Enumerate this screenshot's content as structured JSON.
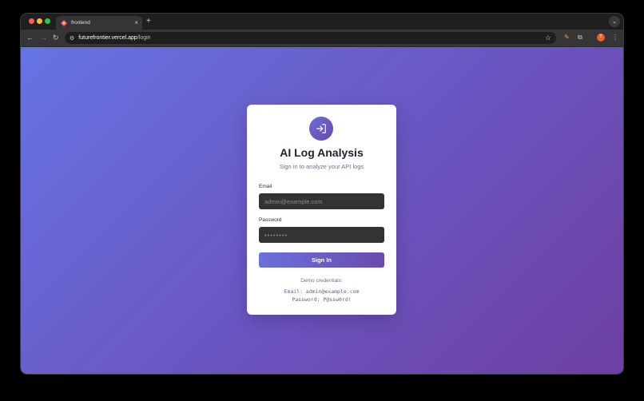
{
  "browser": {
    "tab_title": "frontend",
    "tab_close": "×",
    "new_tab": "+",
    "url_domain": "futurefrontier.vercel.app",
    "url_path": "/login",
    "profile_initial": "T",
    "icons": {
      "back": "back-arrow-icon",
      "forward": "forward-arrow-icon",
      "reload": "reload-icon",
      "site_info": "site-info-icon",
      "bookmark": "star-icon",
      "extension_pen": "pen-icon",
      "extensions": "puzzle-icon",
      "menu": "kebab-menu-icon",
      "tab_search": "chevron-down-icon"
    }
  },
  "login": {
    "title": "AI Log Analysis",
    "subtitle": "Sign in to analyze your API logs",
    "email_label": "Email",
    "email_placeholder": "admin@example.com",
    "password_label": "Password",
    "password_placeholder": "••••••••",
    "signin_label": "Sign In",
    "demo_title": "Demo credentials:",
    "demo_email": "Email: admin@example.com",
    "demo_password": "Password: P@ssw0rd!",
    "logo_icon": "sign-in-icon"
  },
  "colors": {
    "gradient_start": "#6674e3",
    "gradient_end": "#6d3fa1",
    "button_start": "#6a71dc",
    "button_end": "#6b4aaf",
    "input_bg": "#333333"
  }
}
